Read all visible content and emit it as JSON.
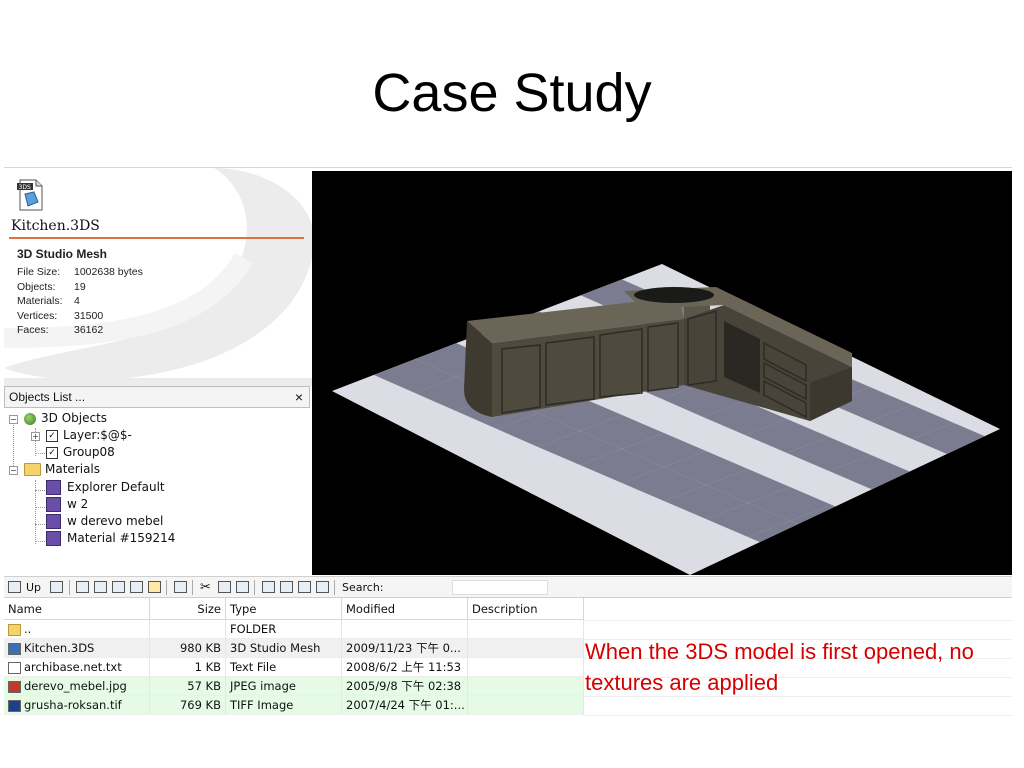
{
  "slide": {
    "title": "Case Study"
  },
  "info": {
    "icon_label": "3DS",
    "file_name": "Kitchen.3DS",
    "file_type": "3D Studio Mesh",
    "stats": [
      {
        "key": "File Size:",
        "value": "1002638 bytes"
      },
      {
        "key": "Objects:",
        "value": "19"
      },
      {
        "key": "Materials:",
        "value": "4"
      },
      {
        "key": "Vertices:",
        "value": "31500"
      },
      {
        "key": "Faces:",
        "value": "36162"
      }
    ]
  },
  "objects_panel": {
    "title": "Objects List  ...",
    "close": "×",
    "tree": {
      "root": "3D Objects",
      "layer": "Layer:$@$-",
      "group": "Group08",
      "materials_folder": "Materials",
      "materials": [
        "Explorer Default",
        "w 2",
        "w  derevo mebel",
        "Material #159214"
      ]
    }
  },
  "toolbar": {
    "up_label": "Up",
    "search_label": "Search:",
    "search_value": ""
  },
  "file_list": {
    "columns": [
      "Name",
      "Size",
      "Type",
      "Modified",
      "Description"
    ],
    "rows": [
      {
        "name": "..",
        "size": "",
        "type": "FOLDER",
        "modified": "",
        "description": ""
      },
      {
        "name": "Kitchen.3DS",
        "size": "980 KB",
        "type": "3D Studio Mesh",
        "modified": "2009/11/23 下午 0...",
        "description": ""
      },
      {
        "name": "archibase.net.txt",
        "size": "1 KB",
        "type": "Text File",
        "modified": "2008/6/2 上午 11:53",
        "description": ""
      },
      {
        "name": "derevo_mebel.jpg",
        "size": "57 KB",
        "type": "JPEG image",
        "modified": "2005/9/8 下午 02:38",
        "description": ""
      },
      {
        "name": "grusha-roksan.tif",
        "size": "769 KB",
        "type": "TIFF Image",
        "modified": "2007/4/24 下午 01:...",
        "description": ""
      }
    ]
  },
  "caption": "When the 3DS model is first opened, no textures are applied",
  "colors": {
    "caption": "#d40000",
    "accent_rule": "#e07040",
    "viewport_bg": "#000000",
    "tile_light": "#dcdce4",
    "tile_dark": "#7c7c90",
    "cabinet": "#4e4a3e"
  }
}
